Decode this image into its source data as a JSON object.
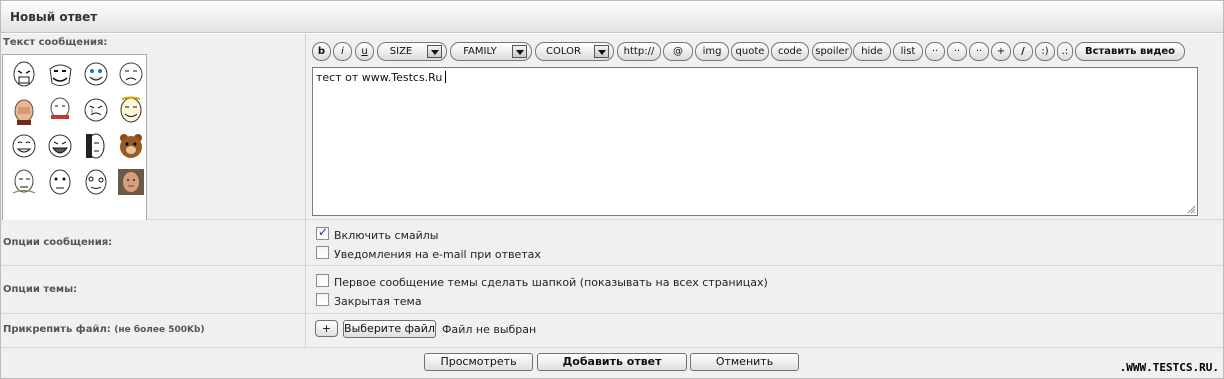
{
  "header": {
    "title": "Новый ответ"
  },
  "message": {
    "label": "Текст сообщения:",
    "smileys": [
      "rage-face-icon",
      "troll-face-icon",
      "happy-face-icon",
      "sad-face-icon",
      "facepalm-icon",
      "fuck-yea-icon",
      "cry-face-icon",
      "yao-ming-icon",
      "lol-face-icon",
      "laugh-face-icon",
      "dark-face-icon",
      "pedobear-icon",
      "forever-alone-icon",
      "neutral-face-icon",
      "derp-face-icon",
      "photo-face-icon"
    ],
    "toolbar": {
      "bold": "b",
      "italic": "i",
      "underline": "u",
      "size": "SIZE",
      "family": "FAMILY",
      "color": "COLOR",
      "url": "http://",
      "email": "@",
      "img": "img",
      "quote": "quote",
      "code": "code",
      "spoiler": "spoiler",
      "hide": "hide",
      "list": "list",
      "b1": "··",
      "b2": "··",
      "b3": "··",
      "plus": "+",
      "slash": "/",
      "paren": ":)",
      "dots": ".:",
      "video": "Вставить видео"
    },
    "text": "тест от www.Testcs.Ru"
  },
  "options": {
    "label": "Опции сообщения:",
    "enable_smileys": {
      "label": "Включить смайлы",
      "checked": true
    },
    "email_notify": {
      "label": "Уведомления на e-mail при ответах",
      "checked": false
    }
  },
  "topic": {
    "label": "Опции темы:",
    "pin_first": {
      "label": "Первое сообщение темы сделать шапкой (показывать на всех страницах)",
      "checked": false
    },
    "closed": {
      "label": "Закрытая тема",
      "checked": false
    }
  },
  "attach": {
    "label": "Прикрепить файл:",
    "note": "(не более 500Kb)",
    "plus": "+",
    "choose": "Выберите файл",
    "status": "Файл не выбран"
  },
  "footer": {
    "preview": "Просмотреть",
    "submit": "Добавить ответ",
    "cancel": "Отменить"
  },
  "watermark": ".WWW.TESTCS.RU."
}
